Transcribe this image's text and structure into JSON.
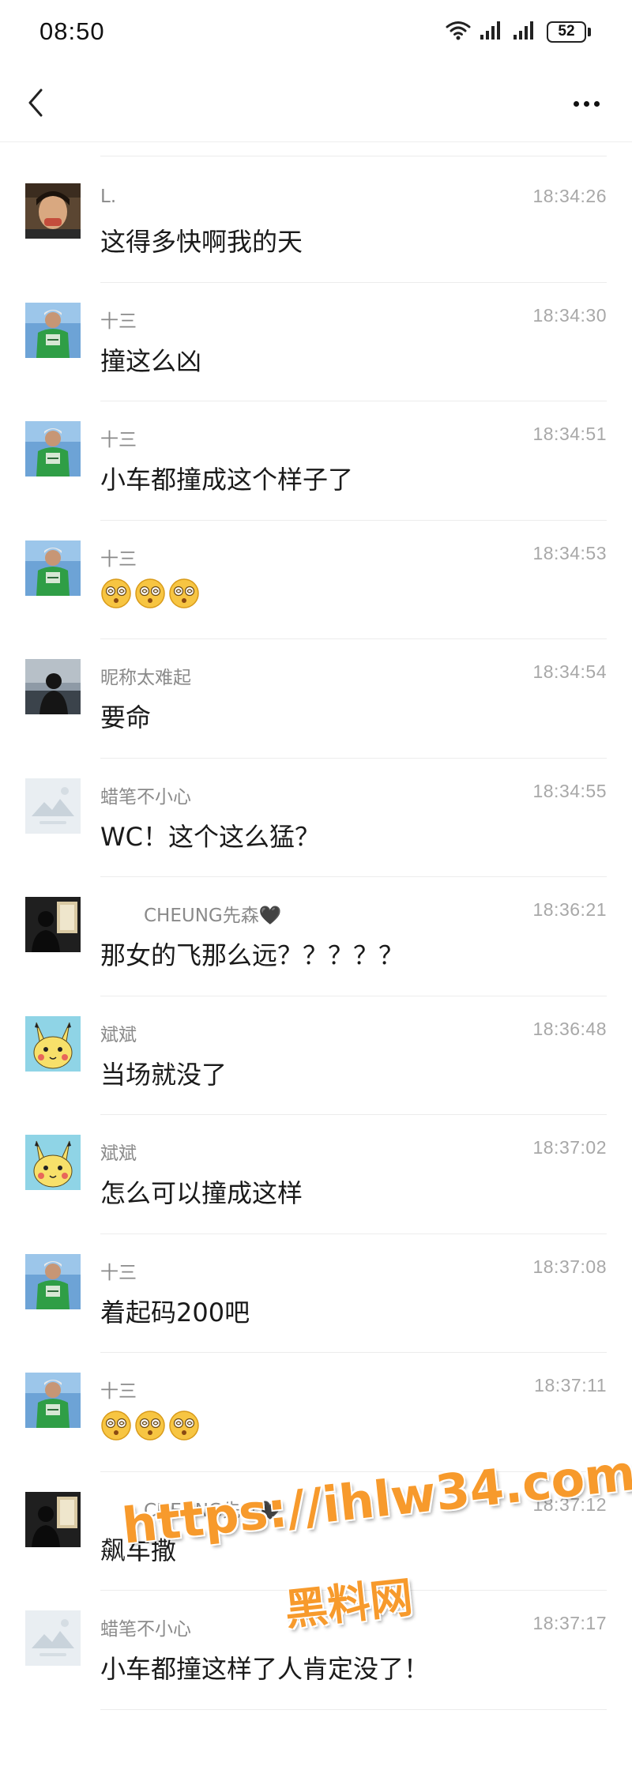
{
  "status_bar": {
    "time": "08:50",
    "battery": "52",
    "battery_level": 0.52,
    "icons": [
      "wifi-icon",
      "signal-icon",
      "signal-icon",
      "battery-icon"
    ]
  },
  "nav": {
    "back_icon": "chevron-left-icon",
    "more_icon": "more-horizontal-icon"
  },
  "comments": [
    {
      "user": "L.",
      "time": "18:34:26",
      "text": "这得多快啊我的天",
      "avatar": "photo"
    },
    {
      "user": "十三",
      "time": "18:34:30",
      "text": "撞这么凶",
      "avatar": "green"
    },
    {
      "user": "十三",
      "time": "18:34:51",
      "text": "小车都撞成这个样子了",
      "avatar": "green"
    },
    {
      "user": "十三",
      "time": "18:34:53",
      "text": "",
      "emoji": [
        "dizzy-face-emoji",
        "dizzy-face-emoji",
        "dizzy-face-emoji"
      ],
      "avatar": "green"
    },
    {
      "user": "昵称太难起",
      "time": "18:34:54",
      "text": "要命",
      "avatar": "dark"
    },
    {
      "user": "蜡笔不小心",
      "time": "18:34:55",
      "text": "WC！这个这么猛？",
      "avatar": "default"
    },
    {
      "user": "CHEUNG先森🖤",
      "time": "18:36:21",
      "text": "那女的飞那么远？？？？？",
      "avatar": "dark2",
      "indent": true
    },
    {
      "user": "斌斌",
      "time": "18:36:48",
      "text": "当场就没了",
      "avatar": "pikachu"
    },
    {
      "user": "斌斌",
      "time": "18:37:02",
      "text": "怎么可以撞成这样",
      "avatar": "pikachu"
    },
    {
      "user": "十三",
      "time": "18:37:08",
      "text": "着起码200吧",
      "avatar": "green"
    },
    {
      "user": "十三",
      "time": "18:37:11",
      "text": "",
      "emoji": [
        "dizzy-face-emoji",
        "dizzy-face-emoji",
        "dizzy-face-emoji"
      ],
      "avatar": "green"
    },
    {
      "user": "CHEUNG先森🖤",
      "time": "18:37:12",
      "text": "飙车撒",
      "avatar": "dark2",
      "indent": true
    },
    {
      "user": "蜡笔不小心",
      "time": "18:37:17",
      "text": "小车都撞这样了人肯定没了！",
      "avatar": "default"
    }
  ],
  "watermark": {
    "url": "https://ihlw34.com",
    "name": "黑料网",
    "color": "#f79a2c"
  }
}
